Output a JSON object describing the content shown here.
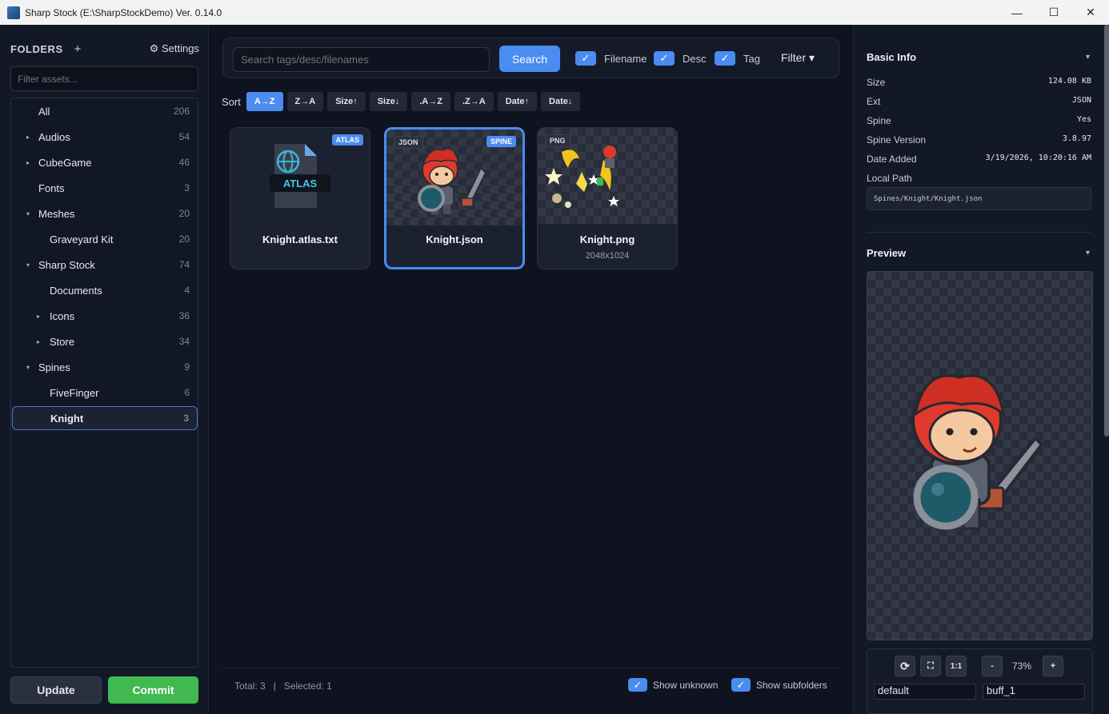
{
  "window": {
    "title": "Sharp Stock (E:\\SharpStockDemo) Ver. 0.14.0"
  },
  "sidebar": {
    "header": "FOLDERS",
    "add_label": "+",
    "settings_label": "⚙ Settings",
    "filter_placeholder": "Filter assets...",
    "items": [
      {
        "label": "All",
        "count": "206",
        "caret": "",
        "indent": 0
      },
      {
        "label": "Audios",
        "count": "54",
        "caret": "▸",
        "indent": 0
      },
      {
        "label": "CubeGame",
        "count": "46",
        "caret": "▸",
        "indent": 0
      },
      {
        "label": "Fonts",
        "count": "3",
        "caret": "",
        "indent": 0
      },
      {
        "label": "Meshes",
        "count": "20",
        "caret": "▾",
        "indent": 0
      },
      {
        "label": "Graveyard Kit",
        "count": "20",
        "caret": "",
        "indent": 1
      },
      {
        "label": "Sharp Stock",
        "count": "74",
        "caret": "▾",
        "indent": 0
      },
      {
        "label": "Documents",
        "count": "4",
        "caret": "",
        "indent": 1
      },
      {
        "label": "Icons",
        "count": "36",
        "caret": "▸",
        "indent": 1
      },
      {
        "label": "Store",
        "count": "34",
        "caret": "▸",
        "indent": 1
      },
      {
        "label": "Spines",
        "count": "9",
        "caret": "▾",
        "indent": 0
      },
      {
        "label": "FiveFinger",
        "count": "6",
        "caret": "",
        "indent": 1
      },
      {
        "label": "Knight",
        "count": "3",
        "caret": "",
        "indent": 1,
        "selected": true
      }
    ],
    "update_label": "Update",
    "commit_label": "Commit"
  },
  "search": {
    "placeholder": "Search tags/desc/filenames",
    "button_label": "Search",
    "filename_label": "Filename",
    "desc_label": "Desc",
    "tag_label": "Tag",
    "filter_label": "Filter ▾"
  },
  "sort": {
    "label": "Sort",
    "options": [
      "A→Z",
      "Z→A",
      "Size↑",
      "Size↓",
      ".A→Z",
      ".Z→A",
      "Date↑",
      "Date↓"
    ],
    "active": "A→Z"
  },
  "assets": [
    {
      "name": "Knight.atlas.txt",
      "badge_right": "ATLAS",
      "badge_left": "",
      "dims": "",
      "icon_label": "ATLAS"
    },
    {
      "name": "Knight.json",
      "badge_right": "SPINE",
      "badge_left": "JSON",
      "dims": "",
      "selected": true
    },
    {
      "name": "Knight.png",
      "badge_right": "",
      "badge_left": "PNG",
      "dims": "2048x1024"
    }
  ],
  "status": {
    "total": "Total: 3   |   Selected: 1",
    "show_unknown": "Show unknown",
    "show_subfolders": "Show subfolders"
  },
  "info": {
    "title": "Basic Info",
    "caret": "▾",
    "rows": [
      {
        "label": "Size",
        "value": "124.08 KB"
      },
      {
        "label": "Ext",
        "value": "JSON"
      },
      {
        "label": "Spine",
        "value": "Yes"
      },
      {
        "label": "Spine Version",
        "value": "3.8.97"
      },
      {
        "label": "Date Added",
        "value": "3/19/2026, 10:20:16 AM"
      }
    ],
    "local_path_label": "Local Path",
    "local_path": "Spines/Knight/Knight.json"
  },
  "preview": {
    "title": "Preview",
    "caret": "▾",
    "reload_icon": "⟳",
    "fit_icon": "⛶",
    "one_to_one": "1:1",
    "zoom_out": "-",
    "zoom_level": "73%",
    "zoom_in": "+",
    "skin": "default",
    "animation": "buff_1"
  },
  "colors": {
    "accent": "#4a8cf0",
    "commit": "#3fb950"
  }
}
